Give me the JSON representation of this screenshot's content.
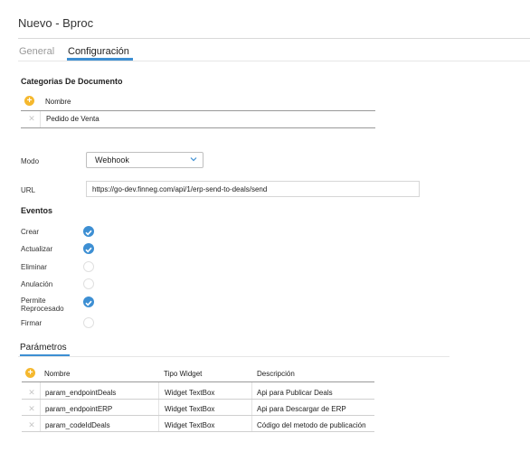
{
  "window": {
    "title": "Nuevo - Bproc"
  },
  "tabs": [
    {
      "label": "General"
    },
    {
      "label": "Configuración"
    }
  ],
  "categorias": {
    "heading": "Categorias De Documento",
    "column": "Nombre",
    "rows": [
      {
        "nombre": "Pedido de Venta"
      }
    ]
  },
  "modo": {
    "label": "Modo",
    "value": "Webhook"
  },
  "url": {
    "label": "URL",
    "value": "https://go-dev.finneg.com/api/1/erp-send-to-deals/send"
  },
  "eventos": {
    "heading": "Eventos",
    "items": [
      {
        "label": "Crear",
        "checked": true
      },
      {
        "label": "Actualizar",
        "checked": true
      },
      {
        "label": "Eliminar",
        "checked": false
      },
      {
        "label": "Anulación",
        "checked": false
      },
      {
        "label": "Permite",
        "label2": "Reprocesado",
        "checked": true
      },
      {
        "label": "Firmar",
        "checked": false
      }
    ]
  },
  "parametros": {
    "heading": "Parámetros",
    "columns": {
      "nombre": "Nombre",
      "tipo": "Tipo Widget",
      "descripcion": "Descripción"
    },
    "rows": [
      {
        "nombre": "param_endpointDeals",
        "tipo": "Widget TextBox",
        "descripcion": "Api para Publicar Deals"
      },
      {
        "nombre": "param_endpointERP",
        "tipo": "Widget TextBox",
        "descripcion": "Api para Descargar de ERP"
      },
      {
        "nombre": "param_codeIdDeals",
        "tipo": "Widget TextBox",
        "descripcion": "Código del metodo de publicación"
      }
    ]
  },
  "colors": {
    "accent": "#3d8fd3",
    "add": "#f5b82e"
  }
}
